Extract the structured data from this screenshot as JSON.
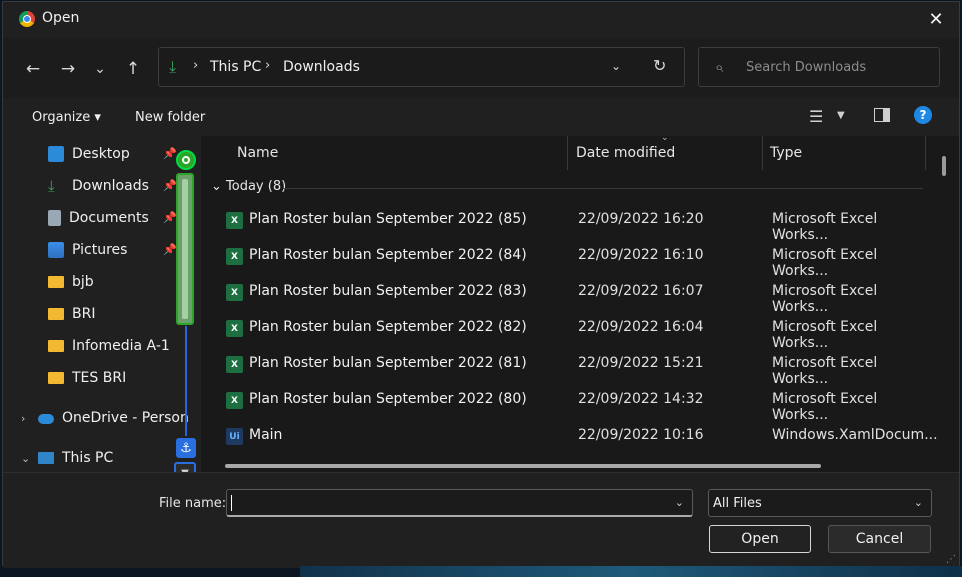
{
  "window": {
    "title": "Open",
    "close_glyph": "✕"
  },
  "nav": {
    "back_glyph": "←",
    "forward_glyph": "→",
    "recent_glyph": "⌄",
    "up_glyph": "↑",
    "breadcrumb": [
      "This PC",
      "Downloads"
    ],
    "search_placeholder": "Search Downloads"
  },
  "commands": {
    "organize": "Organize ▾",
    "new_folder": "New folder",
    "help": "?"
  },
  "sidebar": {
    "items": [
      {
        "label": "Desktop",
        "icon": "desktop-icon",
        "pinned": true
      },
      {
        "label": "Downloads",
        "icon": "download-icon",
        "pinned": true
      },
      {
        "label": "Documents",
        "icon": "documents-icon",
        "pinned": true
      },
      {
        "label": "Pictures",
        "icon": "pictures-icon",
        "pinned": true
      },
      {
        "label": "bjb",
        "icon": "folder-icon",
        "pinned": false
      },
      {
        "label": "BRI",
        "icon": "folder-icon",
        "pinned": false
      },
      {
        "label": "Infomedia A-1",
        "icon": "folder-icon",
        "pinned": false
      },
      {
        "label": "TES BRI",
        "icon": "folder-icon",
        "pinned": false
      },
      {
        "label": "OneDrive - Person",
        "icon": "cloud-icon",
        "pinned": false
      },
      {
        "label": "This PC",
        "icon": "computer-icon",
        "pinned": false
      }
    ]
  },
  "columns": {
    "name": "Name",
    "date": "Date modified",
    "type": "Type"
  },
  "group": {
    "label": "Today (8)"
  },
  "files": [
    {
      "name": "Plan Roster bulan September 2022 (85)",
      "date": "22/09/2022 16:20",
      "type": "Microsoft Excel Works...",
      "icon": "excel-icon"
    },
    {
      "name": "Plan Roster bulan September 2022 (84)",
      "date": "22/09/2022 16:10",
      "type": "Microsoft Excel Works...",
      "icon": "excel-icon"
    },
    {
      "name": "Plan Roster bulan September 2022 (83)",
      "date": "22/09/2022 16:07",
      "type": "Microsoft Excel Works...",
      "icon": "excel-icon"
    },
    {
      "name": "Plan Roster bulan September 2022 (82)",
      "date": "22/09/2022 16:04",
      "type": "Microsoft Excel Works...",
      "icon": "excel-icon"
    },
    {
      "name": "Plan Roster bulan September 2022 (81)",
      "date": "22/09/2022 15:21",
      "type": "Microsoft Excel Works...",
      "icon": "excel-icon"
    },
    {
      "name": "Plan Roster bulan September 2022 (80)",
      "date": "22/09/2022 14:32",
      "type": "Microsoft Excel Works...",
      "icon": "excel-icon"
    },
    {
      "name": "Main",
      "date": "22/09/2022 10:16",
      "type": "Windows.XamlDocum...",
      "icon": "xaml-icon"
    }
  ],
  "footer": {
    "file_name_label": "File name:",
    "file_name_value": "",
    "file_type": "All Files",
    "open_label": "Open",
    "cancel_label": "Cancel"
  },
  "colors": {
    "accent": "#1e88e5",
    "excel": "#1d6f42",
    "overlay_green": "#2aa52a",
    "overlay_blue": "#2a6fe0"
  }
}
